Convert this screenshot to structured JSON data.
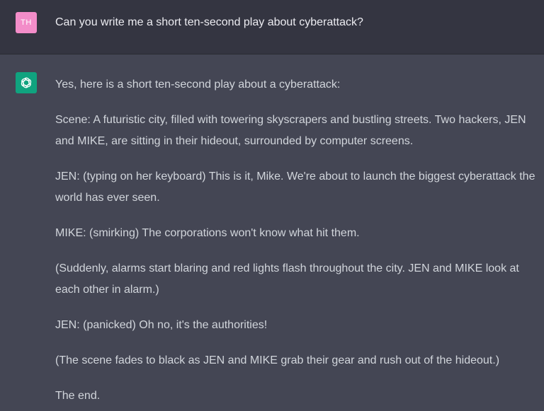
{
  "user_message": {
    "avatar_initials": "TH",
    "text": "Can you write me a short ten-second play about cyberattack?"
  },
  "assistant_message": {
    "avatar_icon": "openai-logo-icon",
    "paragraphs": [
      "Yes, here is a short ten-second play about a cyberattack:",
      "Scene: A futuristic city, filled with towering skyscrapers and bustling streets. Two hackers, JEN and MIKE, are sitting in their hideout, surrounded by computer screens.",
      "JEN: (typing on her keyboard) This is it, Mike. We're about to launch the biggest cyberattack the world has ever seen.",
      "MIKE: (smirking) The corporations won't know what hit them.",
      "(Suddenly, alarms start blaring and red lights flash throughout the city. JEN and MIKE look at each other in alarm.)",
      "JEN: (panicked) Oh no, it's the authorities!",
      "(The scene fades to black as JEN and MIKE grab their gear and rush out of the hideout.)",
      "The end."
    ]
  },
  "colors": {
    "user_bg": "#343541",
    "assistant_bg": "#444654",
    "user_avatar": "#f38dc9",
    "bot_avatar": "#10a37f",
    "text": "#d1d5db"
  }
}
